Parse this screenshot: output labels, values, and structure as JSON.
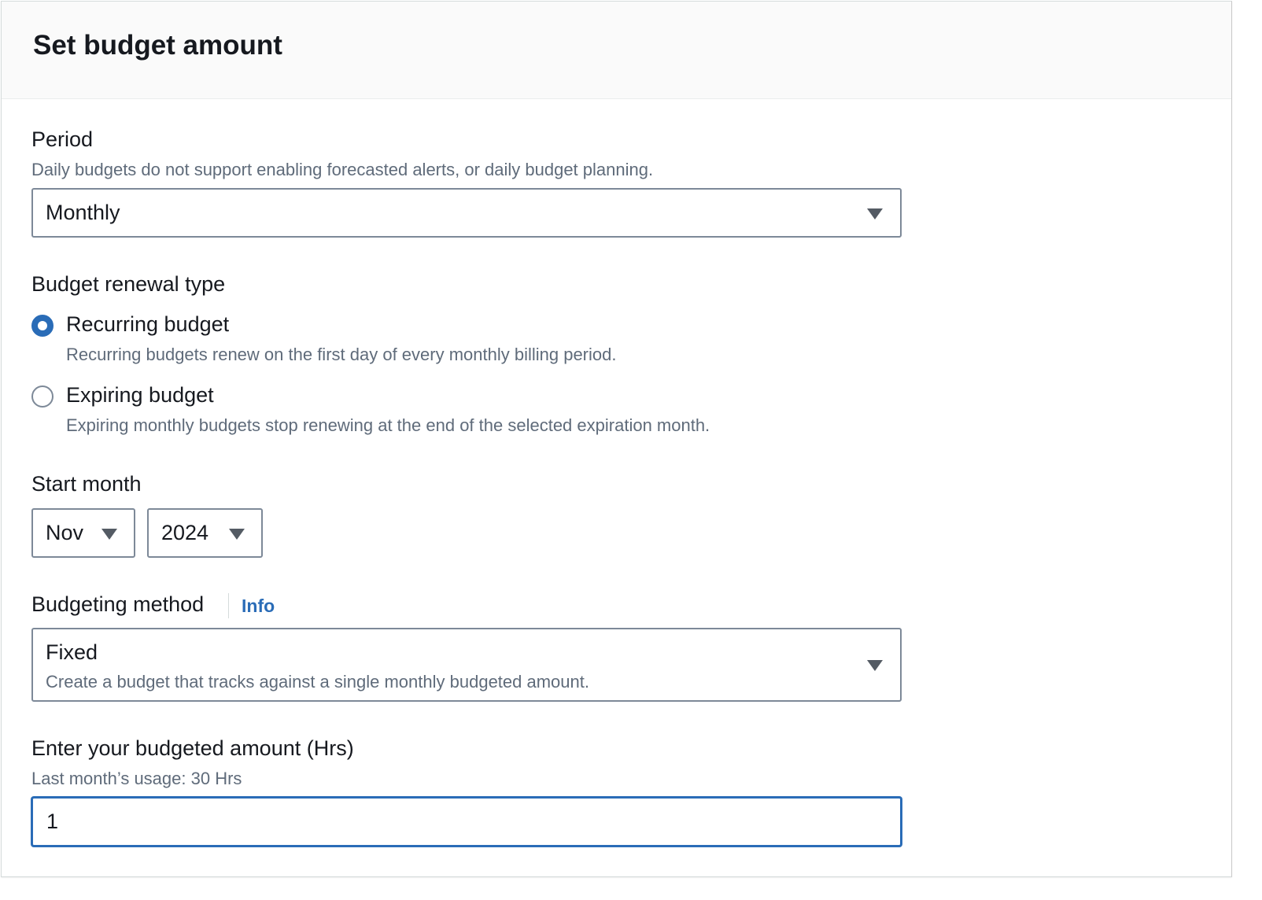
{
  "header": {
    "title": "Set budget amount"
  },
  "period": {
    "label": "Period",
    "description": "Daily budgets do not support enabling forecasted alerts, or daily budget planning.",
    "selected": "Monthly"
  },
  "renewal": {
    "label": "Budget renewal type",
    "options": [
      {
        "label": "Recurring budget",
        "description": "Recurring budgets renew on the first day of every monthly billing period.",
        "checked": true
      },
      {
        "label": "Expiring budget",
        "description": "Expiring monthly budgets stop renewing at the end of the selected expiration month.",
        "checked": false
      }
    ]
  },
  "start_month": {
    "label": "Start month",
    "month": "Nov",
    "year": "2024"
  },
  "budgeting_method": {
    "label": "Budgeting method",
    "info_link": "Info",
    "selected": "Fixed",
    "selected_description": "Create a budget that tracks against a single monthly budgeted amount."
  },
  "amount": {
    "label": "Enter your budgeted amount (Hrs)",
    "hint": "Last month’s usage: 30 Hrs",
    "value": "1"
  },
  "colors": {
    "accent": "#2a6cb7",
    "text": "#16191f",
    "secondary_text": "#5f6b7a",
    "border": "#7d8998"
  }
}
